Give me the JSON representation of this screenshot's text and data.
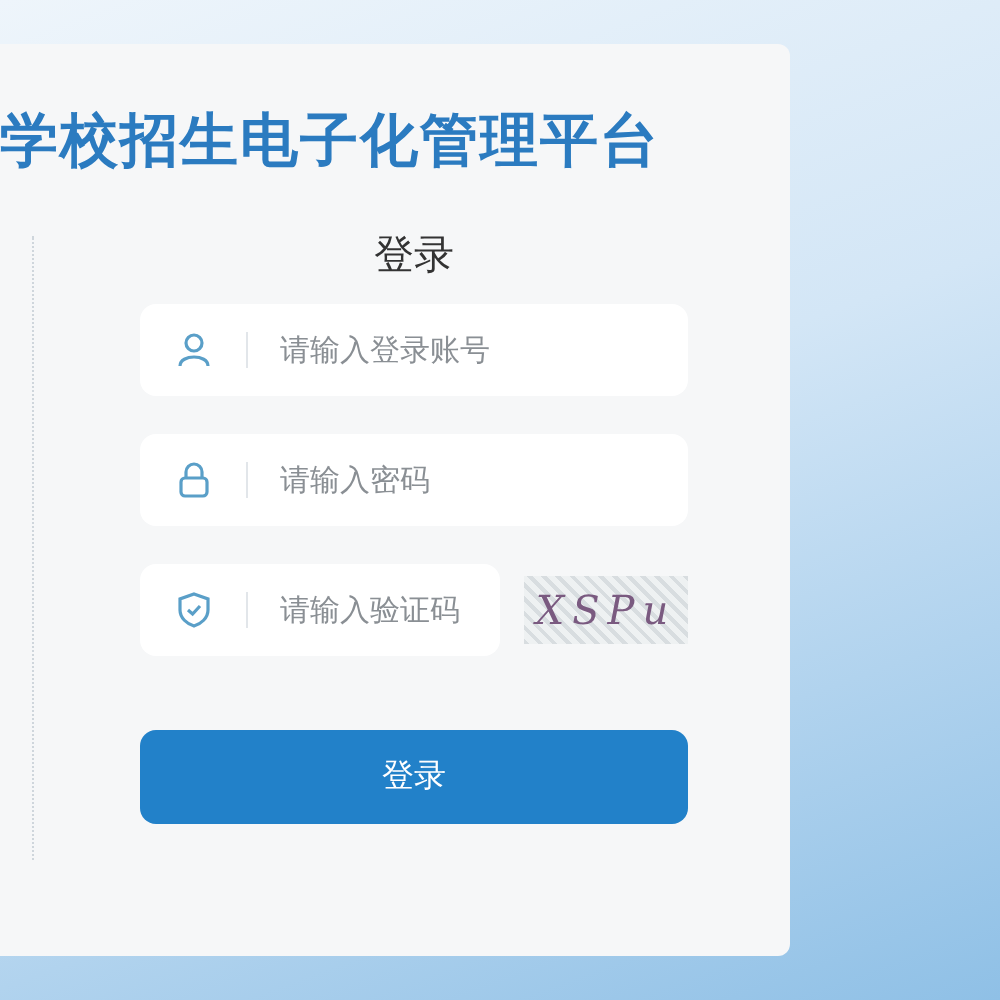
{
  "title": "学校招生电子化管理平台",
  "login": {
    "heading": "登录",
    "fields": [
      {
        "kind": "user",
        "placeholder": "请输入登录账号"
      },
      {
        "kind": "lock",
        "placeholder": "请输入密码"
      },
      {
        "kind": "shield",
        "placeholder": "请输入验证码"
      }
    ],
    "captcha": "XSPu",
    "button": "登录"
  }
}
